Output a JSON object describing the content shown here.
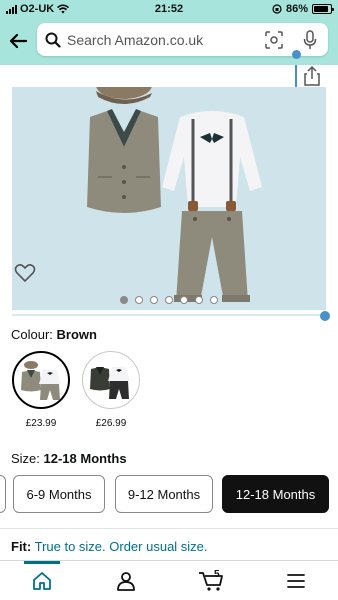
{
  "status_bar": {
    "carrier": "O2-UK",
    "time": "21:52",
    "battery_percent": "86%"
  },
  "search": {
    "placeholder": "Search Amazon.co.uk"
  },
  "gallery": {
    "image_count": 7,
    "active_index": 0
  },
  "colour": {
    "label": "Colour: ",
    "selected": "Brown",
    "options": [
      {
        "name": "Brown",
        "price": "£23.99"
      },
      {
        "name": "Dark",
        "price": "£26.99"
      }
    ]
  },
  "size": {
    "label": "Size: ",
    "selected": "12-18 Months",
    "options": [
      "6-9 Months",
      "9-12 Months",
      "12-18 Months"
    ]
  },
  "fit": {
    "label": "Fit:",
    "text": "True to size. Order usual size."
  },
  "nav": {
    "cart_count": "5",
    "items": [
      "home-icon",
      "account-icon",
      "cart-icon",
      "menu-icon"
    ]
  },
  "colors": {
    "header_bg": "#a6e4dc",
    "link": "#007185",
    "accent_dot": "#4a90c8"
  }
}
